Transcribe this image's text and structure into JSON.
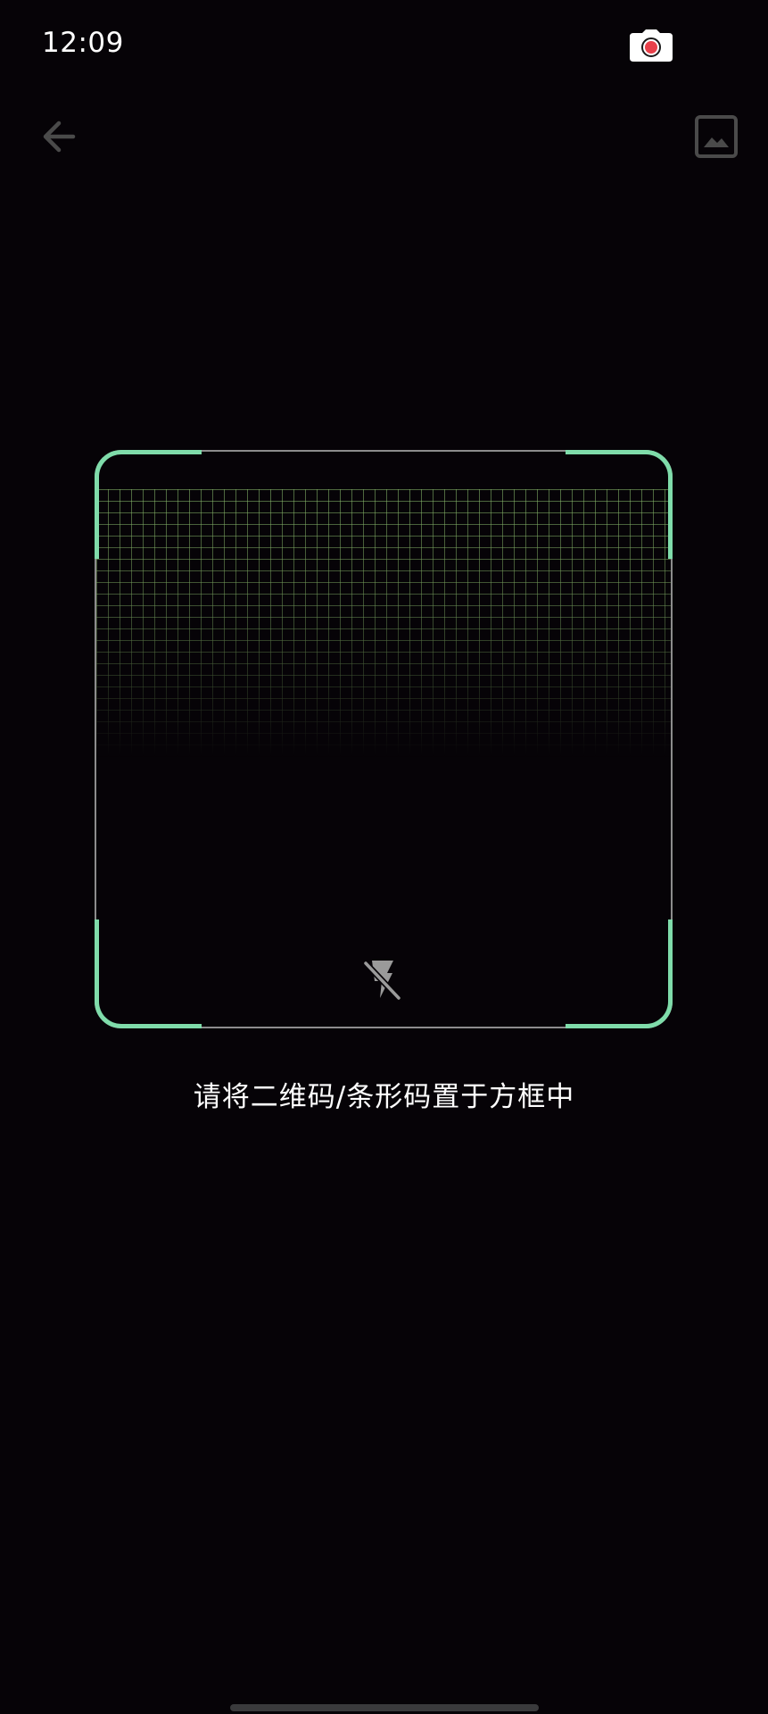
{
  "status_bar": {
    "time": "12:09",
    "camera_indicator_icon": "camera-recording-icon"
  },
  "toolbar": {
    "back_icon": "arrow-left-icon",
    "gallery_icon": "image-gallery-icon"
  },
  "scanner": {
    "frame_corner_color": "#7fdcaa",
    "frame_border_color": "#8c8c8c",
    "grid_color": "#8cbe6e",
    "flash_icon": "flash-off-icon",
    "flash_state": "off"
  },
  "hint": {
    "text": "请将二维码/条形码置于方框中"
  },
  "colors": {
    "background": "#060307",
    "text": "#ffffff",
    "dim_icon": "#4a4a4a"
  }
}
